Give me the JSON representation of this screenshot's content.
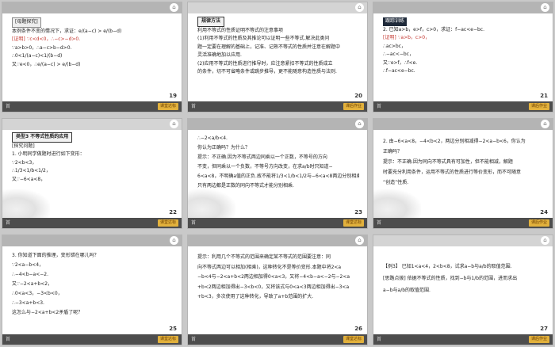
{
  "slides": [
    {
      "page": "19",
      "bar": "dark",
      "lines": [
        "[母题探究]",
        "本例条件不变的情况下，求证：e/(a−c) > e/(b−d)",
        "[证明]  ∵c<d<0，∴−c>−d>0.",
        "∵a>b>0，∴a−c>b−d>0.",
        "∴0<1/(a−c)<1/(b−d)",
        "又∵e<0，∴e/(a−c) > e/(b−d)"
      ],
      "nav_label": "首",
      "badge": "课堂达标"
    },
    {
      "page": "20",
      "bar": "light",
      "lines": [
        "规律方法",
        "利用不等式的性质证明不等式的注意事项",
        "(1)利用不等式的性质及其推论可以证明一些不等式.解决此类问",
        "题一定要在理解的基础上，记准、记熟不等式的性质并注意在解题中",
        "灵活准确地加以应用.",
        "(2)应用不等式的性质进行推导时，应注意紧扣不等式的性质成立",
        "的条件，切不可省略条件或跳步推导，更不能随意构造性质与法则."
      ],
      "nav_label": "首",
      "badge": "课后作业"
    },
    {
      "page": "21",
      "bar": "dark",
      "lines": [
        "跟踪训练",
        "2.  已知a>b，e>f，c>0，求证：f−ac<e−bc.",
        "[证明]  ∵a>b，c>0，",
        "∴ac>bc，",
        "∴−ac<−bc，",
        "又∵e>f，∴f<e.",
        "∴f−ac<e−bc."
      ],
      "nav_label": "首",
      "badge": "课后作业"
    },
    {
      "page": "22",
      "bar": "dark",
      "lines": [
        "类型3  不等式性质的应用",
        "[探究问题]",
        "1. 小明同学做题时进行如下变形：",
        "∵2<b<3，",
        "∴1/3<1/b<1/2，",
        "又∵−6<a<8，"
      ],
      "nav_label": "首",
      "badge": "课堂达标"
    },
    {
      "page": "23",
      "bar": "dark",
      "lines": [
        "∴−2<a/b<4.",
        "你认为正确吗？为什么？",
        "提示：不正确.因为不等式两边同乘以一个正数，不等号的方向",
        "不变，但同乘以一个负数，不等号方向改变，在求a/b时只知道−",
        "6<a<8，不明确a值的正负.故不能将1/3<1/b<1/2与−6<a<8两边分别相乘，",
        "只有两边都是正数的同向不等式才能分别相乘."
      ],
      "nav_label": "首",
      "badge": "课堂达标"
    },
    {
      "page": "24",
      "bar": "dark",
      "lines": [
        "2. 由−6<a<8，−4<b<2，两边分别相减得−2<a−b<6，你认为",
        "正确吗？",
        "提示：不正确.因为同向不等式具有可加性，但不能相减，解题",
        "时要充分利用条件，运用不等式的性质进行等价变形，而不可随意",
        "“创造”性质."
      ],
      "nav_label": "首",
      "badge": "课后作业"
    },
    {
      "page": "25",
      "bar": "dark",
      "lines": [
        "3. 你知道下面的推理，变形错在哪儿吗？",
        "∵2<a−b<4，",
        "∴−4<b−a<−2.",
        "又∵−2<a+b<2，",
        "∴0<a<3，−3<b<0，",
        "∴−3<a+b<3.",
        "这怎么与−2<a+b<2矛盾了呢？"
      ],
      "nav_label": "首",
      "badge": "课堂达标"
    },
    {
      "page": "26",
      "bar": "dark",
      "lines": [
        "提示：利用几个不等式的范围来确定某不等式的范围要注意：同",
        "向不等式两边可以相加(相乘)，这种转化不是等价变形.本题中将2<a",
        "−b<4与−2<a+b<2两边相加得0<a<3，又将−4<b−a<−2与−2<a",
        "+b<2两边相加得出−3<b<0，又将该式与0<a<3两边相加得出−3<a",
        "+b<3，多次使用了这种转化，导致了a+b范围的扩大."
      ],
      "nav_label": "首",
      "badge": "课堂达标"
    },
    {
      "page": "27",
      "bar": "light",
      "lines": [
        "【例3】  已知1<a<4，2<b<8，试求a−b与a/b的取值范围.",
        "[思路点拨]  依据不等式的性质，找到−b与1/b的范围，进而求出",
        "a−b与a/b的取值范围."
      ],
      "nav_label": "首",
      "badge": "课后作业"
    }
  ],
  "icons": {
    "home": "home-icon",
    "nav": "first-page-icon"
  }
}
